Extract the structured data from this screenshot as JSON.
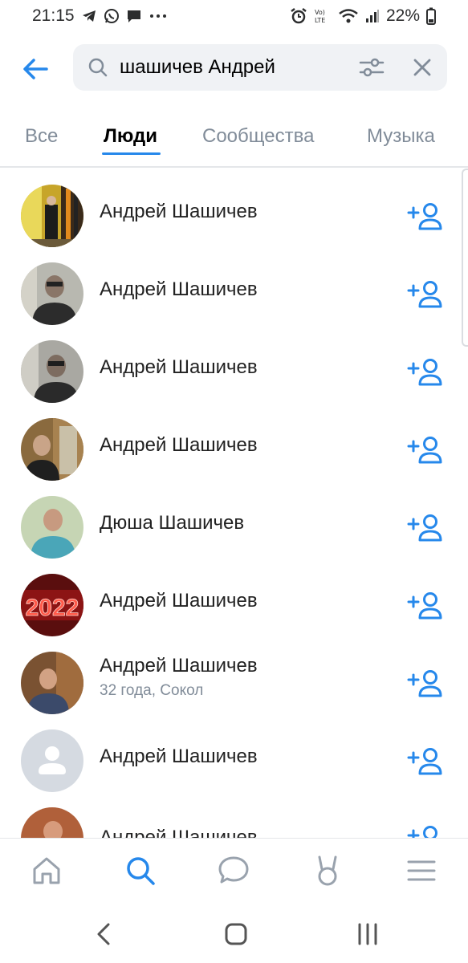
{
  "status_bar": {
    "time": "21:15",
    "battery": "22%",
    "left_icons": [
      "telegram-icon",
      "whatsapp-icon",
      "message-icon",
      "more-icon"
    ],
    "right_icons": [
      "alarm-icon",
      "volte-icon",
      "wifi-icon",
      "signal-icon",
      "battery-icon"
    ]
  },
  "search": {
    "query": "шашичев Андрей"
  },
  "tabs": [
    {
      "label": "Все",
      "active": false
    },
    {
      "label": "Люди",
      "active": true
    },
    {
      "label": "Сообщества",
      "active": false
    },
    {
      "label": "Музыка",
      "active": false
    }
  ],
  "people": [
    {
      "name": "Андрей Шашичев",
      "subtitle": ""
    },
    {
      "name": "Андрей Шашичев",
      "subtitle": ""
    },
    {
      "name": "Андрей Шашичев",
      "subtitle": ""
    },
    {
      "name": "Андрей Шашичев",
      "subtitle": ""
    },
    {
      "name": "Дюша Шашичев",
      "subtitle": ""
    },
    {
      "name": "Андрей Шашичев",
      "subtitle": "",
      "avatar_text": "2022"
    },
    {
      "name": "Андрей Шашичев",
      "subtitle": "32 года, Сокол"
    },
    {
      "name": "Андрей Шашичев",
      "subtitle": ""
    },
    {
      "name": "Андрей Шашичев",
      "subtitle": ""
    }
  ],
  "bottom_nav": [
    "home-icon",
    "search-icon",
    "messages-icon",
    "clips-icon",
    "menu-icon"
  ],
  "colors": {
    "accent": "#2688eb",
    "secondary_text": "#818c99",
    "search_bg": "#f0f2f5"
  }
}
